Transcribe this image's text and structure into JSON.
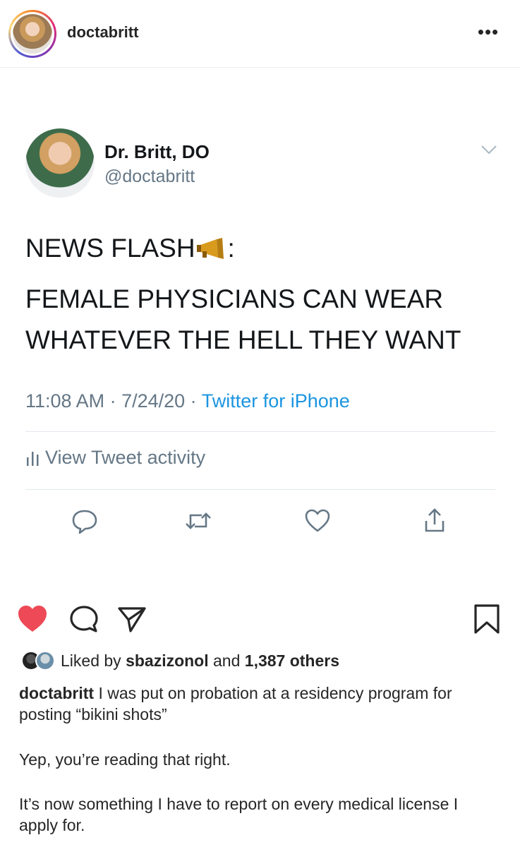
{
  "post_header": {
    "username": "doctabritt",
    "more_label": "•••"
  },
  "tweet": {
    "name": "Dr. Britt, DO",
    "handle": "@doctabritt",
    "line1_before": "NEWS FLASH",
    "line1_after": ":",
    "line2": "FEMALE PHYSICIANS CAN WEAR",
    "line3": "WHATEVER THE HELL THEY WANT",
    "time": "11:08 AM",
    "date": "7/24/20",
    "separator": " · ",
    "source": "Twitter for iPhone",
    "activity_label": "View Tweet activity"
  },
  "post_actions": {
    "liked_prefix": "Liked by ",
    "liked_user": "sbazizonol",
    "liked_middle": " and ",
    "liked_count": "1,387 others"
  },
  "caption": {
    "username": "doctabritt",
    "text1": " I was put on probation at a residency program for posting “bikini shots”",
    "text2": "Yep, you’re reading that right.",
    "text3": "It’s now something I have to report on every medical license I apply for."
  },
  "colors": {
    "like_heart": "#ed4956",
    "twitter_link": "#1b95e0",
    "twitter_gray": "#657786"
  }
}
